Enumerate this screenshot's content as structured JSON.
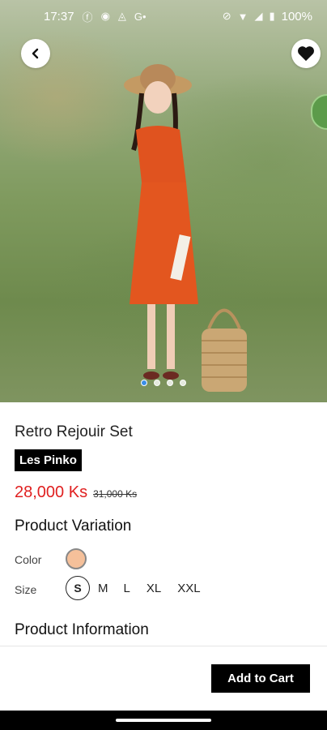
{
  "status_bar": {
    "time": "17:37",
    "battery": "100%"
  },
  "carousel": {
    "slide_count": 4,
    "active_index": 0
  },
  "product": {
    "name": "Retro Rejouir Set",
    "brand": "Les Pinko",
    "price": "28,000 Ks",
    "original_price": "31,000 Ks"
  },
  "variation": {
    "title": "Product Variation",
    "color_label": "Color",
    "size_label": "Size",
    "swatch_color": "#f5c09a",
    "sizes": [
      "S",
      "M",
      "L",
      "XL",
      "XXL"
    ],
    "selected_size": "S"
  },
  "info": {
    "title": "Product Information"
  },
  "actions": {
    "add_to_cart": "Add to Cart"
  },
  "colors": {
    "price": "#e02020",
    "brand_bg": "#000000",
    "dot_active": "#3a8ee6"
  }
}
